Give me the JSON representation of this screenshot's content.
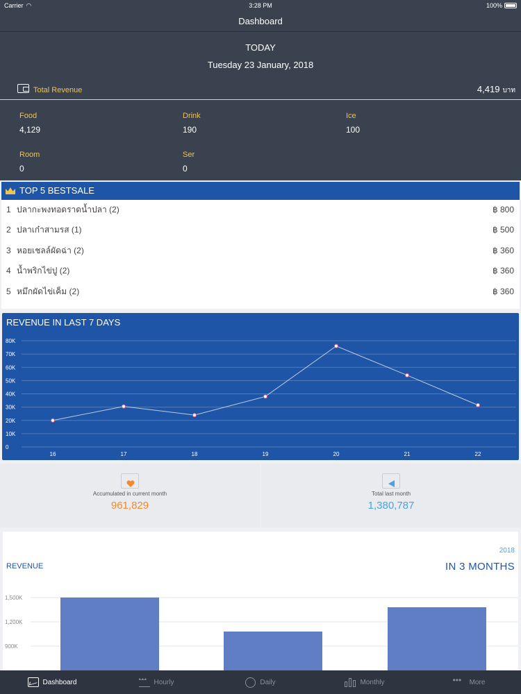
{
  "status_bar": {
    "carrier": "Carrier",
    "time": "3:28 PM",
    "battery": "100%"
  },
  "nav": {
    "title": "Dashboard"
  },
  "summary": {
    "today_label": "TODAY",
    "date": "Tuesday 23 January, 2018",
    "total_revenue_label": "Total Revenue",
    "total_revenue_value": "4,419",
    "currency_unit": "บาท",
    "categories": [
      {
        "label": "Food",
        "value": "4,129"
      },
      {
        "label": "Drink",
        "value": "190"
      },
      {
        "label": "Ice",
        "value": "100"
      },
      {
        "label": "Room",
        "value": "0"
      },
      {
        "label": "Ser",
        "value": "0"
      }
    ]
  },
  "top5": {
    "title": "TOP 5 BESTSALE",
    "items": [
      {
        "rank": "1",
        "name": "ปลากะพงทอดราดน้ำปลา (2)",
        "price": "฿ 800"
      },
      {
        "rank": "2",
        "name": "ปลาเก๋าสามรส (1)",
        "price": "฿ 500"
      },
      {
        "rank": "3",
        "name": "หอยเชลล์ผัดฉ่า (2)",
        "price": "฿ 360"
      },
      {
        "rank": "4",
        "name": "น้ำพริกไข่ปู (2)",
        "price": "฿ 360"
      },
      {
        "rank": "5",
        "name": "หมึกผัดไข่เค็ม (2)",
        "price": "฿ 360"
      }
    ]
  },
  "week_chart": {
    "title": "REVENUE IN LAST 7 DAYS"
  },
  "accumulated": {
    "current_label": "Accumulated in current month",
    "current_value": "961,829",
    "last_label": "Total last month",
    "last_value": "1,380,787",
    "current_color": "#f08a2c",
    "last_color": "#4aa3e0"
  },
  "months_chart": {
    "year": "2018",
    "title_left": "REVENUE",
    "title_right": "IN 3 MONTHS"
  },
  "tabs": [
    {
      "label": "Dashboard",
      "active": true
    },
    {
      "label": "Hourly",
      "active": false
    },
    {
      "label": "Daily",
      "active": false
    },
    {
      "label": "Monthly",
      "active": false
    },
    {
      "label": "More",
      "active": false
    }
  ],
  "chart_data": [
    {
      "type": "line",
      "title": "REVENUE IN LAST 7 DAYS",
      "x": [
        "16",
        "17",
        "18",
        "19",
        "20",
        "21",
        "22"
      ],
      "series": [
        {
          "values": [
            20000,
            30500,
            24000,
            38000,
            76000,
            54000,
            31500
          ]
        }
      ],
      "y_ticks": [
        "0",
        "10K",
        "20K",
        "30K",
        "40K",
        "50K",
        "60K",
        "70K",
        "80K"
      ],
      "ylim": [
        0,
        80000
      ],
      "grid": true
    },
    {
      "type": "bar",
      "categories": [
        "",
        "",
        ""
      ],
      "values": [
        1500000,
        1080000,
        1380000
      ],
      "y_ticks": [
        "900K",
        "1,200K",
        "1,500K"
      ],
      "grid": true
    }
  ]
}
